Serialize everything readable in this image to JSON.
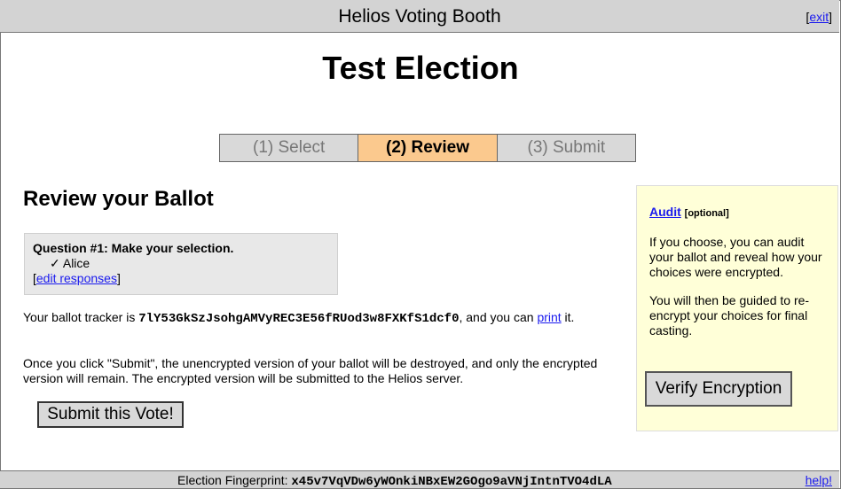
{
  "header": {
    "title": "Helios Voting Booth",
    "exit_label": "exit"
  },
  "election": {
    "name": "Test Election"
  },
  "steps": [
    {
      "label": "(1) Select",
      "active": false
    },
    {
      "label": "(2) Review",
      "active": true
    },
    {
      "label": "(3) Submit",
      "active": false
    }
  ],
  "review": {
    "heading": "Review your Ballot",
    "question_title": "Question #1: Make your selection.",
    "choice_mark": "✓",
    "choice": "Alice",
    "edit_link": "edit responses",
    "tracker_prefix": "Your ballot tracker is ",
    "tracker_hash": "7lY53GkSzJsohgAMVyREC3E56fRUod3w8FXKfS1dcf0",
    "tracker_mid": ", and you can ",
    "print_link": "print",
    "tracker_suffix": " it.",
    "notice": "Once you click \"Submit\", the unencrypted version of your ballot will be destroyed, and only the encrypted version will remain. The encrypted version will be submitted to the Helios server.",
    "submit_label": "Submit this Vote!"
  },
  "audit": {
    "title": "Audit",
    "optional": "[optional]",
    "para1": "If you choose, you can audit your ballot and reveal how your choices were encrypted.",
    "para2": "You will then be guided to re-encrypt your choices for final casting.",
    "verify_label": "Verify Encryption"
  },
  "footer": {
    "fingerprint_label": "Election Fingerprint: ",
    "fingerprint": "x45v7VqVDw6yWOnkiNBxEW2GOgo9aVNjIntnTVO4dLA",
    "help_label": "help!"
  },
  "colors": {
    "header_bg": "#d3d3d3",
    "active_step": "#fbc98e",
    "audit_bg": "#ffffd8",
    "link": "#1a1aee"
  }
}
